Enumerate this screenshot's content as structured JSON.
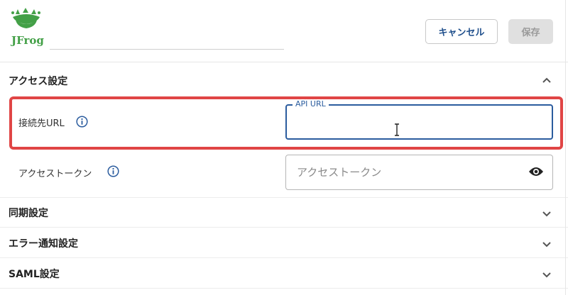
{
  "header": {
    "logo_text": "JFrog",
    "name_value": "",
    "cancel_label": "キャンセル",
    "save_label": "保存"
  },
  "access_section": {
    "title": "アクセス設定",
    "expanded": true,
    "url_label": "接続先URL",
    "url_field_legend": "API URL",
    "url_value": "",
    "token_label": "アクセストークン",
    "token_placeholder": "アクセストークン",
    "token_value": ""
  },
  "sections": [
    {
      "title": "同期設定",
      "expanded": false
    },
    {
      "title": "エラー通知設定",
      "expanded": false
    },
    {
      "title": "SAML設定",
      "expanded": false
    }
  ],
  "colors": {
    "accent": "#2b5c9e",
    "highlight": "#e04545",
    "logo_green": "#43a047",
    "save_disabled_bg": "#e0e0e0"
  }
}
